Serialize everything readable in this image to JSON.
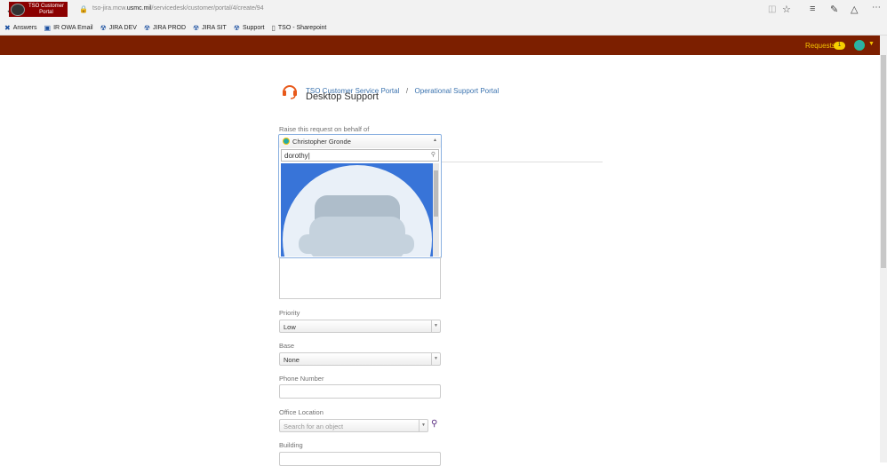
{
  "browser": {
    "url_prefix": "tso-jira.mcw.",
    "url_domain": "usmc.mil",
    "url_path": "/servicedesk/customer/portal/4/create/94"
  },
  "bookmarks": [
    "Answers",
    "IR OWA Email",
    "JIRA DEV",
    "JIRA PROD",
    "JIRA SIT",
    "Support",
    "TSO - Sharepoint"
  ],
  "header": {
    "logo_line1": "TSO Customer",
    "logo_line2": "Portal",
    "requests_label": "Requests",
    "requests_count": "1"
  },
  "breadcrumb": {
    "portal": "TSO Customer Service Portal",
    "sep": "/",
    "sub": "Operational Support Portal"
  },
  "page_title": "Desktop Support",
  "form": {
    "behalf_label": "Raise this request on behalf of",
    "behalf_value": "Christopher Gronde",
    "behalf_search": "dorothy",
    "priority_label": "Priority",
    "priority_value": "Low",
    "base_label": "Base",
    "base_value": "None",
    "phone_label": "Phone Number",
    "phone_value": "",
    "office_label": "Office Location",
    "office_placeholder": "Search for an object",
    "building_label": "Building",
    "building_value": ""
  },
  "colors": {
    "header": "#7c1f00",
    "highlight": "#3874d8",
    "link": "#3b73af"
  }
}
